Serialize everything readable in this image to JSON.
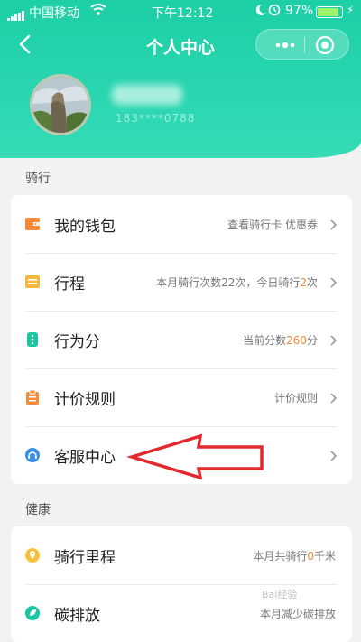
{
  "status_bar": {
    "carrier": "中国移动",
    "time": "下午12:12",
    "battery_percent": "97%",
    "battery_level": 0.97
  },
  "nav": {
    "title": "个人中心"
  },
  "profile": {
    "phone_masked": "183****0788"
  },
  "sections": [
    {
      "title": "骑行",
      "items": [
        {
          "label": "我的钱包",
          "detail_parts": [
            "查看骑行卡 优惠券"
          ],
          "icon": "wallet-icon",
          "color": "#f58a3c"
        },
        {
          "label": "行程",
          "detail_parts": [
            "本月骑行次数22次，今日骑行",
            "2",
            "次"
          ],
          "icon": "trip-icon",
          "color": "#f6b93b"
        },
        {
          "label": "行为分",
          "detail_parts": [
            "当前分数",
            "260",
            "分"
          ],
          "icon": "score-icon",
          "color": "#19c6a0"
        },
        {
          "label": "计价规则",
          "detail_parts": [
            "计价规则"
          ],
          "icon": "pricing-icon",
          "color": "#f58a3c"
        },
        {
          "label": "客服中心",
          "detail_parts": [
            ""
          ],
          "icon": "customer-service-icon",
          "color": "#3a8ee6"
        }
      ]
    },
    {
      "title": "健康",
      "items": [
        {
          "label": "骑行里程",
          "detail_parts": [
            "本月共骑行",
            "0",
            "千米"
          ],
          "icon": "mileage-icon",
          "color": "#f6c23b"
        },
        {
          "label": "碳排放",
          "detail_parts": [
            "本月减少碳排放"
          ],
          "icon": "carbon-icon",
          "color": "#19c6a0"
        }
      ]
    }
  ],
  "annotation": {
    "color": "#e0282e"
  }
}
